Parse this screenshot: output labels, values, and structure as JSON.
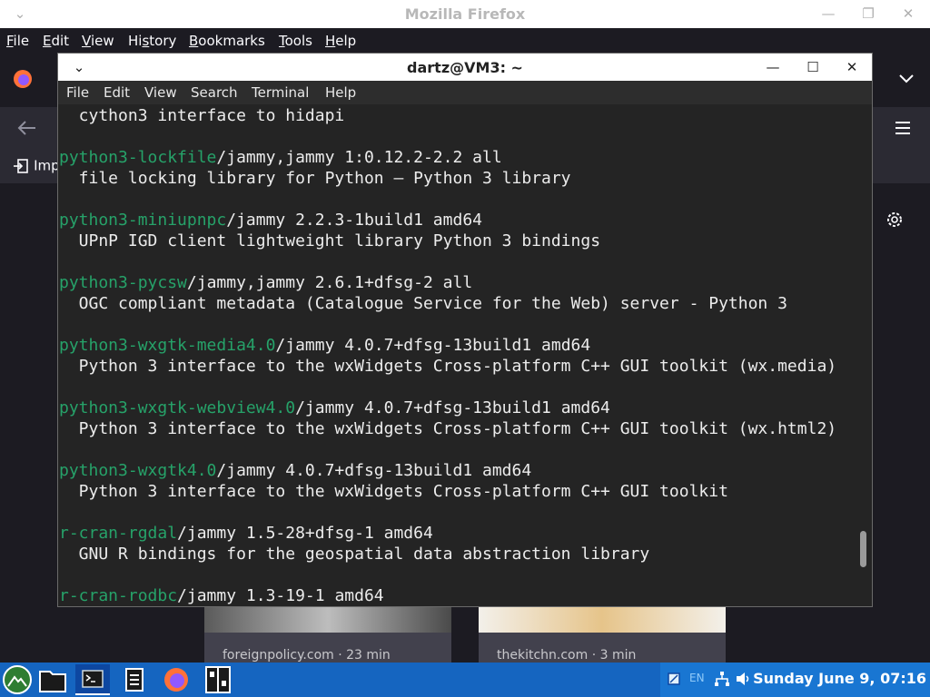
{
  "firefox": {
    "window_title": "Mozilla Firefox",
    "menu": [
      {
        "pre": "",
        "u": "F",
        "post": "ile"
      },
      {
        "pre": "",
        "u": "E",
        "post": "dit"
      },
      {
        "pre": "",
        "u": "V",
        "post": "iew"
      },
      {
        "pre": "Hi",
        "u": "s",
        "post": "tory"
      },
      {
        "pre": "",
        "u": "B",
        "post": "ookmarks"
      },
      {
        "pre": "",
        "u": "T",
        "post": "ools"
      },
      {
        "pre": "",
        "u": "H",
        "post": "elp"
      }
    ],
    "import_label": "Imp",
    "cards": [
      {
        "source": "foreignpolicy.com · 23 min"
      },
      {
        "source": "thekitchn.com · 3 min"
      }
    ]
  },
  "terminal": {
    "title": "dartz@VM3: ~",
    "menu": [
      "File",
      "Edit",
      "View",
      "Search",
      "Terminal",
      "Help"
    ],
    "lines": [
      {
        "pkg": "",
        "rest": "  cython3 interface to hidapi"
      },
      {
        "pkg": "",
        "rest": ""
      },
      {
        "pkg": "python3-lockfile",
        "rest": "/jammy,jammy 1:0.12.2-2.2 all"
      },
      {
        "pkg": "",
        "rest": "  file locking library for Python — Python 3 library"
      },
      {
        "pkg": "",
        "rest": ""
      },
      {
        "pkg": "python3-miniupnpc",
        "rest": "/jammy 2.2.3-1build1 amd64"
      },
      {
        "pkg": "",
        "rest": "  UPnP IGD client lightweight library Python 3 bindings"
      },
      {
        "pkg": "",
        "rest": ""
      },
      {
        "pkg": "python3-pycsw",
        "rest": "/jammy,jammy 2.6.1+dfsg-2 all"
      },
      {
        "pkg": "",
        "rest": "  OGC compliant metadata (Catalogue Service for the Web) server - Python 3"
      },
      {
        "pkg": "",
        "rest": ""
      },
      {
        "pkg": "python3-wxgtk-media4.0",
        "rest": "/jammy 4.0.7+dfsg-13build1 amd64"
      },
      {
        "pkg": "",
        "rest": "  Python 3 interface to the wxWidgets Cross-platform C++ GUI toolkit (wx.media)"
      },
      {
        "pkg": "",
        "rest": ""
      },
      {
        "pkg": "python3-wxgtk-webview4.0",
        "rest": "/jammy 4.0.7+dfsg-13build1 amd64"
      },
      {
        "pkg": "",
        "rest": "  Python 3 interface to the wxWidgets Cross-platform C++ GUI toolkit (wx.html2)"
      },
      {
        "pkg": "",
        "rest": ""
      },
      {
        "pkg": "python3-wxgtk4.0",
        "rest": "/jammy 4.0.7+dfsg-13build1 amd64"
      },
      {
        "pkg": "",
        "rest": "  Python 3 interface to the wxWidgets Cross-platform C++ GUI toolkit"
      },
      {
        "pkg": "",
        "rest": ""
      },
      {
        "pkg": "r-cran-rgdal",
        "rest": "/jammy 1.5-28+dfsg-1 amd64"
      },
      {
        "pkg": "",
        "rest": "  GNU R bindings for the geospatial data abstraction library"
      },
      {
        "pkg": "",
        "rest": ""
      },
      {
        "pkg": "r-cran-rodbc",
        "rest": "/jammy 1.3-19-1 amd64"
      }
    ]
  },
  "taskbar": {
    "keyboard_layout": "EN",
    "clock": "Sunday June  9, 07:16"
  },
  "colors": {
    "package_name": "#26a269",
    "terminal_bg": "#242424",
    "taskbar": "#1565c0"
  }
}
